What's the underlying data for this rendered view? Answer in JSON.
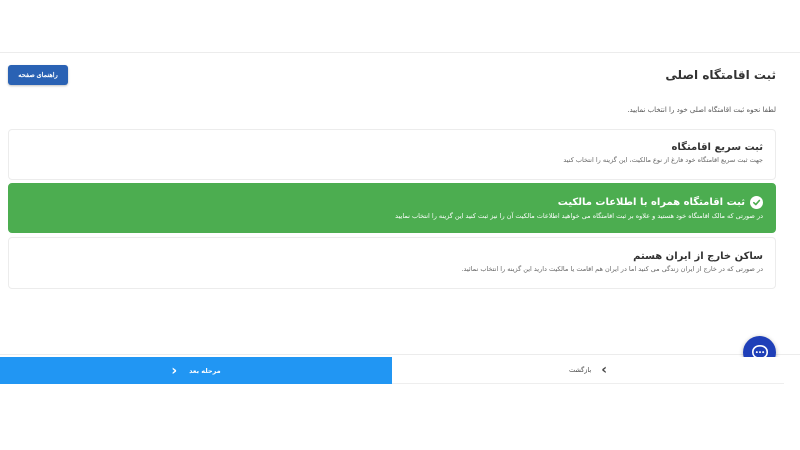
{
  "header": {
    "title": "ثبت اقامتگاه اصلی",
    "help_label": "راهنمای صفحه"
  },
  "instruction": "لطفا نحوه ثبت اقامتگاه اصلی خود را انتخاب نمایید.",
  "options": [
    {
      "title": "ثبت سریع اقامتگاه",
      "description": "جهت ثبت سریع اقامتگاه خود فارغ از نوع مالکیت، این گزینه را انتخاب کنید",
      "selected": false
    },
    {
      "title": "ثبت اقامتگاه همراه با اطلاعات مالکیت",
      "description": "در صورتی که مالک اقامتگاه خود هستید و علاوه بر ثبت اقامتگاه می خواهید اطلاعات مالکیت آن را نیز ثبت کنید این گزینه را انتخاب نمایید",
      "selected": true
    },
    {
      "title": "ساکن خارج از ایران هستم",
      "description": "در صورتی که در خارج از ایران زندگی می کنید اما در ایران هم اقامت یا مالکیت دارید این گزینه را انتخاب نمائید.",
      "selected": false
    }
  ],
  "footer": {
    "back_label": "بازگشت",
    "next_label": "مرحله بعد"
  },
  "icons": {
    "check": "check-circle-icon",
    "chat": "chat-bubble-icon",
    "back": "chevron-right-icon",
    "next": "chevron-left-icon"
  },
  "colors": {
    "primary": "#2a62b4",
    "next_button": "#2196f3",
    "selected_option": "#4cad50",
    "chat_button": "#1f3fb8"
  }
}
